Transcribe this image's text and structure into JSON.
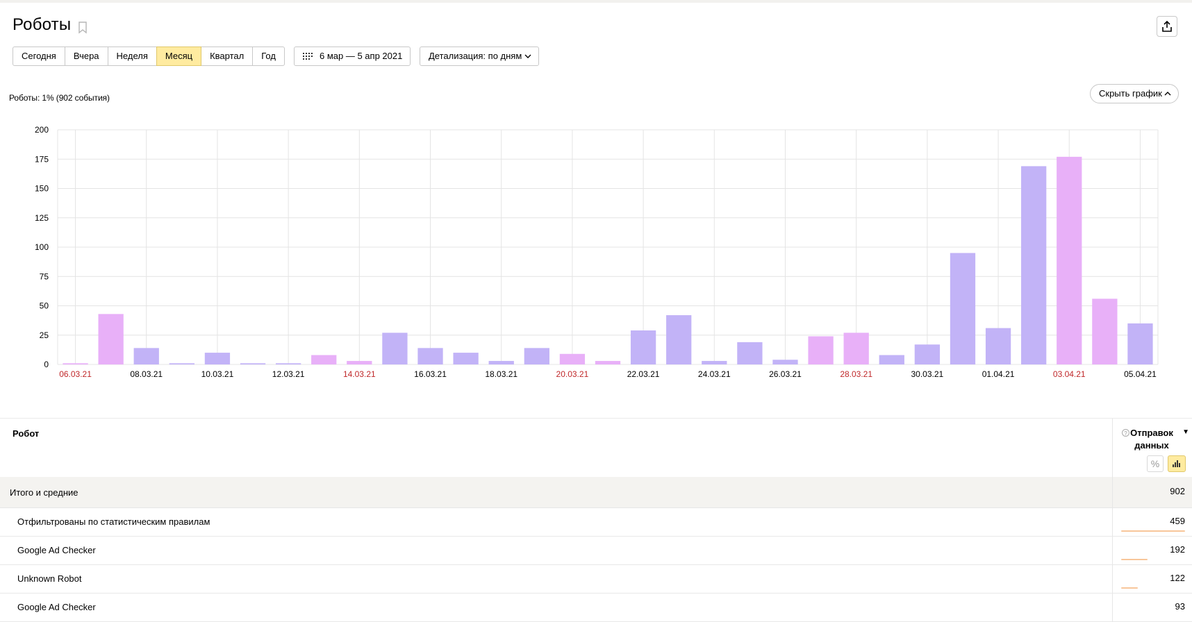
{
  "header": {
    "title": "Роботы",
    "date_range": "6 мар — 5 апр 2021",
    "detail_label": "Детализация: по дням",
    "periods": [
      "Сегодня",
      "Вчера",
      "Неделя",
      "Месяц",
      "Квартал",
      "Год"
    ],
    "active_period": "Месяц"
  },
  "chart_section": {
    "summary": "Роботы: 1% (902 события)",
    "hide_label": "Скрыть график"
  },
  "chart_data": {
    "type": "bar",
    "categories": [
      "06.03.21",
      "07.03.21",
      "08.03.21",
      "09.03.21",
      "10.03.21",
      "11.03.21",
      "12.03.21",
      "13.03.21",
      "14.03.21",
      "15.03.21",
      "16.03.21",
      "17.03.21",
      "18.03.21",
      "19.03.21",
      "20.03.21",
      "21.03.21",
      "22.03.21",
      "23.03.21",
      "24.03.21",
      "25.03.21",
      "26.03.21",
      "27.03.21",
      "28.03.21",
      "29.03.21",
      "30.03.21",
      "31.03.21",
      "01.04.21",
      "02.04.21",
      "03.04.21",
      "04.04.21",
      "05.04.21"
    ],
    "values": [
      1,
      43,
      14,
      1,
      10,
      1,
      1,
      8,
      3,
      27,
      14,
      10,
      3,
      14,
      9,
      3,
      29,
      42,
      3,
      19,
      4,
      24,
      27,
      8,
      17,
      95,
      31,
      169,
      177,
      56,
      35
    ],
    "weekend": [
      true,
      true,
      false,
      false,
      false,
      false,
      false,
      true,
      true,
      false,
      false,
      false,
      false,
      false,
      true,
      true,
      false,
      false,
      false,
      false,
      false,
      true,
      true,
      false,
      false,
      false,
      false,
      false,
      true,
      true,
      false
    ],
    "ylim": [
      0,
      200
    ],
    "yticks": [
      0,
      25,
      50,
      75,
      100,
      125,
      150,
      175,
      200
    ],
    "tick_labels": [
      "06.03.21",
      "08.03.21",
      "10.03.21",
      "12.03.21",
      "14.03.21",
      "16.03.21",
      "18.03.21",
      "20.03.21",
      "22.03.21",
      "24.03.21",
      "26.03.21",
      "28.03.21",
      "30.03.21",
      "01.04.21",
      "03.04.21",
      "05.04.21"
    ],
    "tick_weekend": [
      true,
      false,
      false,
      false,
      true,
      false,
      false,
      true,
      false,
      false,
      false,
      true,
      false,
      false,
      true,
      false
    ],
    "colors": {
      "weekday": "#c2b3f7",
      "weekend": "#e8b0f8",
      "weekend_label": "#c0282a",
      "grid": "#e4e4e4"
    },
    "grid": true
  },
  "table": {
    "col_robot": "Робот",
    "col_metric": "Отправок данных",
    "total": {
      "name": "Итого и средние",
      "value": "902"
    },
    "rows": [
      {
        "name": "Отфильтрованы по статистическим правилам",
        "value": "459",
        "share": 0.509
      },
      {
        "name": "Google Ad Checker",
        "value": "192",
        "share": 0.213
      },
      {
        "name": "Unknown Robot",
        "value": "122",
        "share": 0.135
      },
      {
        "name": "Google Ad Checker",
        "value": "93",
        "share": 0.103
      }
    ]
  }
}
